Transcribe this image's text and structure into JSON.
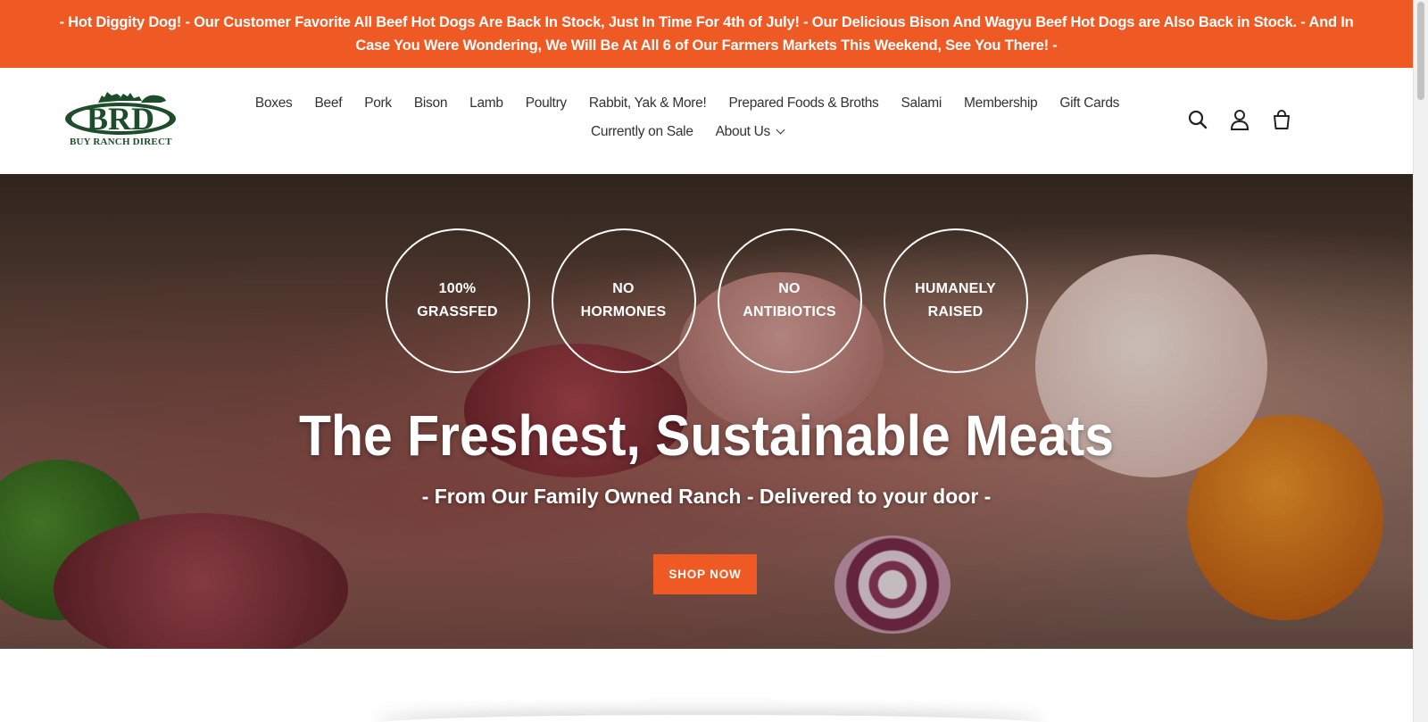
{
  "announcement": {
    "text": "- Hot Diggity Dog! - Our Customer Favorite All Beef Hot Dogs Are Back In Stock, Just In Time For 4th of July! - Our Delicious Bison And Wagyu Beef Hot Dogs are Also Back in Stock. - And In Case You Were Wondering, We Will Be At All 6 of Our Farmers Markets This Weekend, See You There! -"
  },
  "brand": {
    "logo_letters": "BRD",
    "name": "BUY RANCH DIRECT",
    "logo_color": "#1d4d2a"
  },
  "nav": {
    "row1": [
      "Boxes",
      "Beef",
      "Pork",
      "Bison",
      "Lamb",
      "Poultry",
      "Rabbit, Yak & More!",
      "Prepared Foods & Broths",
      "Salami",
      "Membership",
      "Gift Cards"
    ],
    "row2": [
      "Currently on Sale",
      "About Us"
    ]
  },
  "header_icons": [
    "search-icon",
    "account-icon",
    "cart-icon"
  ],
  "hero": {
    "badges": [
      {
        "line1": "100%",
        "line2": "GRASSFED"
      },
      {
        "line1": "NO",
        "line2": "HORMONES"
      },
      {
        "line1": "NO",
        "line2": "ANTIBIOTICS"
      },
      {
        "line1": "HUMANELY",
        "line2": "RAISED"
      }
    ],
    "title": "The Freshest, Sustainable Meats",
    "subtitle": "- From Our Family Owned Ranch - Delivered to your door -",
    "cta": "SHOP NOW"
  },
  "colors": {
    "accent": "#ef5a24",
    "text": "#333333"
  }
}
